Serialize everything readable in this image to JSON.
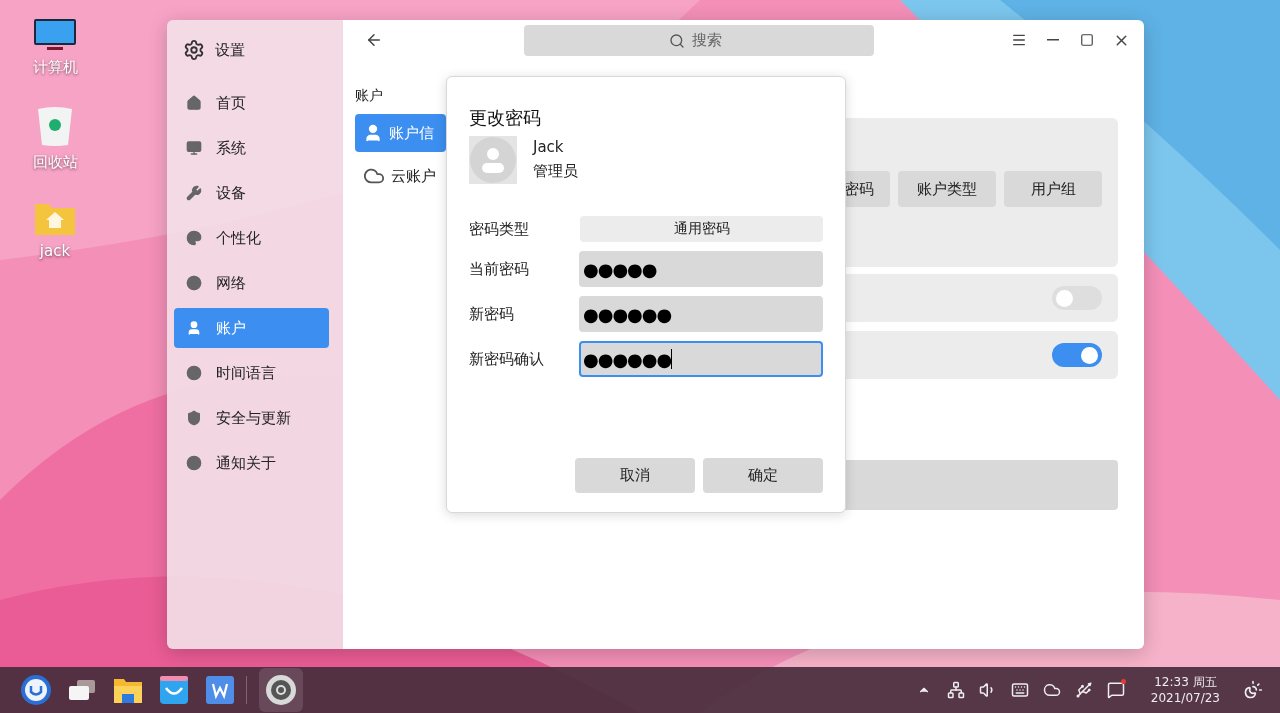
{
  "desktop": {
    "icons": [
      {
        "label": "计算机",
        "kind": "computer"
      },
      {
        "label": "回收站",
        "kind": "trash"
      },
      {
        "label": "jack",
        "kind": "home"
      }
    ]
  },
  "window": {
    "title": "设置",
    "search": {
      "placeholder": "搜索"
    }
  },
  "sidebar": {
    "items": [
      {
        "label": "首页",
        "kind": "home",
        "selected": false
      },
      {
        "label": "系统",
        "kind": "system",
        "selected": false
      },
      {
        "label": "设备",
        "kind": "devices",
        "selected": false
      },
      {
        "label": "个性化",
        "kind": "personalize",
        "selected": false
      },
      {
        "label": "网络",
        "kind": "network",
        "selected": false
      },
      {
        "label": "账户",
        "kind": "account",
        "selected": true
      },
      {
        "label": "时间语言",
        "kind": "time",
        "selected": false
      },
      {
        "label": "安全与更新",
        "kind": "security",
        "selected": false
      },
      {
        "label": "通知关于",
        "kind": "about",
        "selected": false
      }
    ]
  },
  "section": {
    "title": "账户",
    "tabs": [
      {
        "label": "账户信",
        "kind": "user",
        "selected": true
      },
      {
        "label": "云账户",
        "kind": "cloud",
        "selected": false
      }
    ]
  },
  "account_card": {
    "buttons": [
      "密码",
      "账户类型",
      "用户组"
    ]
  },
  "switch_rows": [
    {
      "on": false
    },
    {
      "on": true
    }
  ],
  "dialog": {
    "title": "更改密码",
    "user": {
      "name": "Jack",
      "role": "管理员"
    },
    "fields": [
      {
        "label": "密码类型",
        "kind": "select",
        "value": "通用密码",
        "focused": false
      },
      {
        "label": "当前密码",
        "kind": "password",
        "value": "●●●●●",
        "focused": false
      },
      {
        "label": "新密码",
        "kind": "password",
        "value": "●●●●●●",
        "focused": false
      },
      {
        "label": "新密码确认",
        "kind": "password",
        "value": "●●●●●●",
        "focused": true
      }
    ],
    "buttons": [
      "取消",
      "确定"
    ]
  },
  "taskbar": {
    "apps": [
      {
        "kind": "launcher",
        "active": false
      },
      {
        "kind": "multitask",
        "active": false
      },
      {
        "kind": "files",
        "active": false
      },
      {
        "kind": "store",
        "active": false
      },
      {
        "kind": "writer",
        "active": false
      },
      {
        "kind": "settings",
        "active": true
      }
    ],
    "tray": [
      {
        "kind": "expand"
      },
      {
        "kind": "network"
      },
      {
        "kind": "volume"
      },
      {
        "kind": "keyboard"
      },
      {
        "kind": "cloud"
      },
      {
        "kind": "usb"
      },
      {
        "kind": "notification"
      }
    ],
    "clock": {
      "time": "12:33 周五",
      "date": "2021/07/23"
    }
  }
}
